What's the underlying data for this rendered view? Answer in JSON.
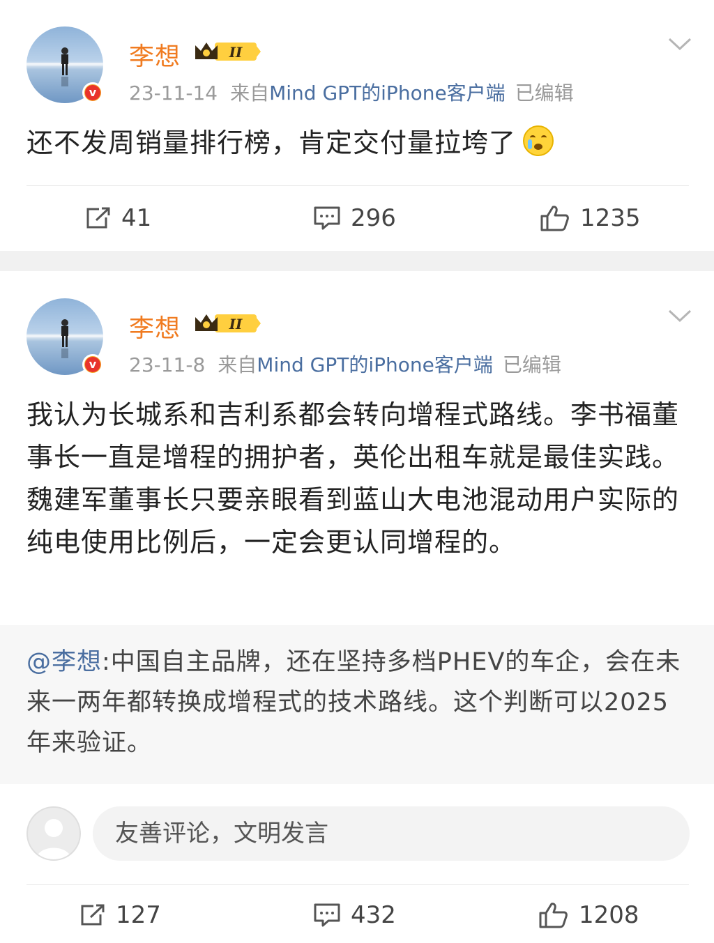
{
  "colors": {
    "name": "#f07b20",
    "link": "#4a6ea0",
    "meta": "#9a9a9a",
    "separator": "#f1f1f1"
  },
  "posts": [
    {
      "author": "李想",
      "date": "23-11-14",
      "source_prefix": "来自",
      "client": "Mind GPT的iPhone客户端",
      "edited": "已编辑",
      "content": "还不发周销量排行榜，肯定交付量拉垮了",
      "emoji": "crying-face-icon",
      "reposts": "41",
      "comments": "296",
      "likes": "1235"
    },
    {
      "author": "李想",
      "date": "23-11-8",
      "source_prefix": "来自",
      "client": "Mind GPT的iPhone客户端",
      "edited": "已编辑",
      "content": "我认为长城系和吉利系都会转向增程式路线。李书福董事长一直是增程的拥护者，英伦出租车就是最佳实践。魏建军董事长只要亲眼看到蓝山大电池混动用户实际的纯电使用比例后，一定会更认同增程的。",
      "quote_mention": "@李想",
      "quote_text": ":中国自主品牌，还在坚持多档PHEV的车企，会在未来一两年都转换成增程式的技术路线。这个判断可以2025年来验证。",
      "comment_placeholder": "友善评论，文明发言",
      "reposts": "127",
      "comments": "432",
      "likes": "1208"
    }
  ],
  "vip_badge_text": "II",
  "verified_badge_text": "v"
}
